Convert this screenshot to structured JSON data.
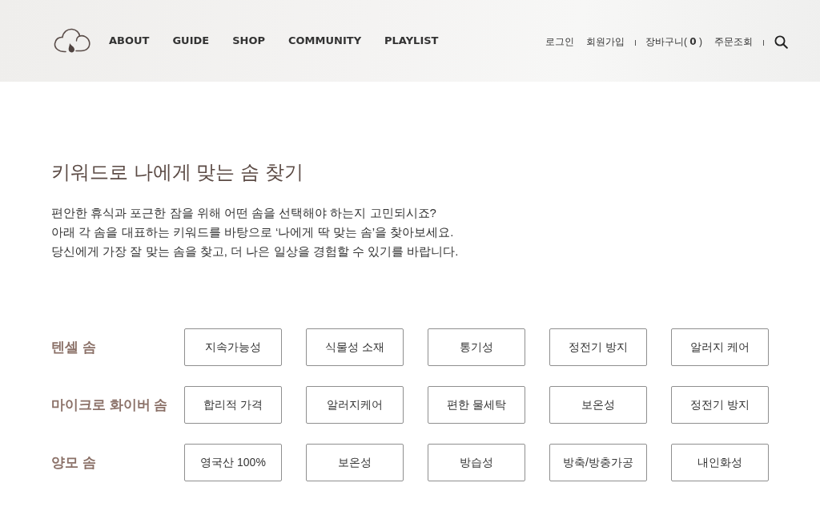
{
  "header": {
    "nav": [
      "ABOUT",
      "GUIDE",
      "SHOP",
      "COMMUNITY",
      "PLAYLIST"
    ],
    "utility_groups": [
      [
        "로그인",
        "회원가입"
      ],
      [
        "장바구니( **0** )",
        "주문조회"
      ]
    ]
  },
  "intro": {
    "title": "키워드로 나에게 맞는 솜 찾기",
    "lines": [
      "편안한 휴식과 포근한 잠을 위해 어떤 솜을 선택해야 하는지 고민되시죠?",
      "아래 각 솜을 대표하는 키워드를 바탕으로 ‘나에게 딱 맞는 솜’을 찾아보세요.",
      "당신에게 가장 잘 맞는 솜을 찾고, 더 나은 일상을 경험할 수 있기를 바랍니다."
    ]
  },
  "categories": [
    {
      "label": "텐셀 솜",
      "keywords": [
        "지속가능성",
        "식물성 소재",
        "통기성",
        "정전기 방지",
        "알러지 케어"
      ]
    },
    {
      "label": "마이크로 화이버 솜",
      "keywords": [
        "합리적 가격",
        "알러지케어",
        "편한 물세탁",
        "보온성",
        "정전기 방지"
      ]
    },
    {
      "label": "양모 솜",
      "keywords": [
        "영국산 100%",
        "보온성",
        "방습성",
        "방축/방충가공",
        "내인화성"
      ]
    }
  ]
}
